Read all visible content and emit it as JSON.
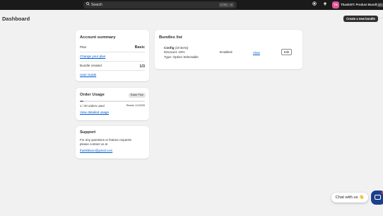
{
  "topbar": {
    "search_label": "Search",
    "kbd_ctrl": "CTRL",
    "kbd_k": "K",
    "store_initials": "TH",
    "store_name": "ThankIST: Product Bundles",
    "store_badge": "dev"
  },
  "page": {
    "title": "Dashboard",
    "create_button": "Create a new bundle",
    "more_button": "⋯"
  },
  "account_summary": {
    "title": "Account summary",
    "plan_label": "Plan",
    "plan_value": "Basic",
    "change_plan_link": "Change your plan",
    "bundles_label": "Bundle created",
    "bundles_value": "1/3",
    "guide_link": "User Guide"
  },
  "order_usage": {
    "title": "Order Usage",
    "plan_badge": "Basic Plan",
    "progress_fraction": 0.05,
    "used_text": "1 / 20 orders used",
    "resets_text": "Resets 1/1/2026",
    "details_link": "View detailed usage"
  },
  "support": {
    "title": "Support",
    "text_line1": "For any questions or feature requests",
    "text_line2": "please contact us at",
    "email": "thankbtaoo@gmail.com"
  },
  "bundles_list": {
    "title": "Bundles list",
    "rows": [
      {
        "name": "Config",
        "items": "(19 items)",
        "discount": "Discount: 15%",
        "type": "Type: Option Selectable",
        "status": "Enabled",
        "view": "View",
        "edit": "Edit"
      }
    ]
  },
  "chat": {
    "label": "Chat with us 👋"
  }
}
